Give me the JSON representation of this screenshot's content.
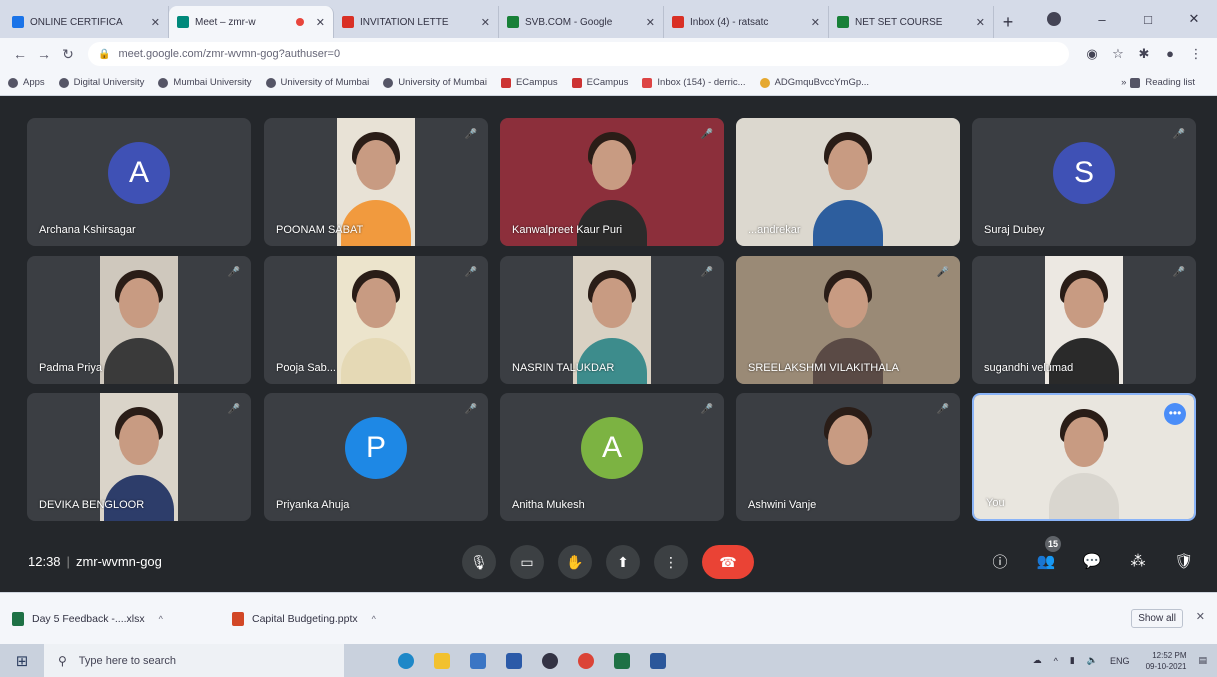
{
  "tabs": [
    {
      "title": "ONLINE CERTIFICA",
      "color": "#1a73e8"
    },
    {
      "title": "Meet – zmr-w",
      "color": "#00897b",
      "recording": true
    },
    {
      "title": "INVITATION LETTE",
      "color": "#d93025"
    },
    {
      "title": "SVB.COM - Google",
      "color": "#188038"
    },
    {
      "title": "Inbox (4) - ratsatc",
      "color": "#d93025"
    },
    {
      "title": "NET SET COURSE",
      "color": "#188038"
    }
  ],
  "window": {
    "new_tab": "+",
    "minimize": "–",
    "maximize": "□",
    "close": "✕"
  },
  "address": {
    "url": "meet.google.com/zmr-wvmn-gog?authuser=0"
  },
  "bookmarks": [
    {
      "label": "Apps",
      "kind": "apps"
    },
    {
      "label": "Digital University",
      "kind": "site"
    },
    {
      "label": "Mumbai University",
      "kind": "site"
    },
    {
      "label": "University of Mumbai",
      "kind": "site"
    },
    {
      "label": "University of Mumbai",
      "kind": "site"
    },
    {
      "label": "ECampus",
      "kind": "ec"
    },
    {
      "label": "ECampus",
      "kind": "ec"
    },
    {
      "label": "Inbox (154) - derric...",
      "kind": "gmail"
    },
    {
      "label": "ADGmquBvccYmGp...",
      "kind": "adg"
    }
  ],
  "bookmarks_more": "»",
  "reading_list": "Reading list",
  "participants": [
    {
      "name": "Archana Kshirsagar",
      "avatar": "A",
      "avatar_color": "#3f51b5"
    },
    {
      "name": "POONAM SABAT",
      "video": true,
      "bg": "#e8e2d6",
      "shirt": "#f19a3e"
    },
    {
      "name": "Kanwalpreet Kaur Puri",
      "video": true,
      "wide": true,
      "bg": "#8c2f3b",
      "shirt": "#2b2b2b"
    },
    {
      "name": "Sandhya Mhapankar Chandrekar",
      "display_name": "...andrekar",
      "video": true,
      "wide": true,
      "bg": "#dcd8cf",
      "shirt": "#2d5e9e"
    },
    {
      "name": "Suraj Dubey",
      "avatar": "S",
      "avatar_color": "#3f51b5"
    },
    {
      "name": "Padma Priya",
      "video": true,
      "bg": "#cfc8bd",
      "shirt": "#3a3a3a"
    },
    {
      "name": "Pooja Sab...",
      "video": true,
      "bg": "#ece4cc",
      "shirt": "#e5d9b5"
    },
    {
      "name": "NASRIN TALUKDAR",
      "video": true,
      "bg": "#d9d1c3",
      "shirt": "#3d8c8c"
    },
    {
      "name": "SREELAKSHMI VILAKITHALA",
      "video": true,
      "wide": true,
      "bg": "#9a8a76",
      "shirt": "#5a4a45"
    },
    {
      "name": "sugandhi velumad",
      "video": true,
      "bg": "#ece8e2",
      "shirt": "#2a2a2a"
    },
    {
      "name": "DEVIKA BENGLOOR",
      "video": true,
      "bg": "#dad4c9",
      "shirt": "#2d3d6a"
    },
    {
      "name": "Priyanka Ahuja",
      "avatar": "P",
      "avatar_color": "#1e88e5"
    },
    {
      "name": "Anitha Mukesh",
      "avatar": "A",
      "avatar_color": "#7cb342"
    },
    {
      "name": "Ashwini Vanje",
      "video": true,
      "bg": "#3b3e43",
      "shirt": "#3b3e43",
      "face_only": true
    },
    {
      "name": "You",
      "video": true,
      "wide": true,
      "bg": "#e9e6df",
      "shirt": "#d9d6cf",
      "self": true
    }
  ],
  "meeting": {
    "time": "12:38",
    "code": "zmr-wvmn-gog",
    "participant_count": "15"
  },
  "downloads": [
    {
      "name": "Day 5 Feedback -....xlsx",
      "color": "#1e7145"
    },
    {
      "name": "Capital Budgeting.pptx",
      "color": "#d24726"
    }
  ],
  "show_all": "Show all",
  "taskbar": {
    "search_placeholder": "Type here to search",
    "time": "12:52 PM",
    "date": "09-10-2021",
    "lang": "ENG"
  }
}
